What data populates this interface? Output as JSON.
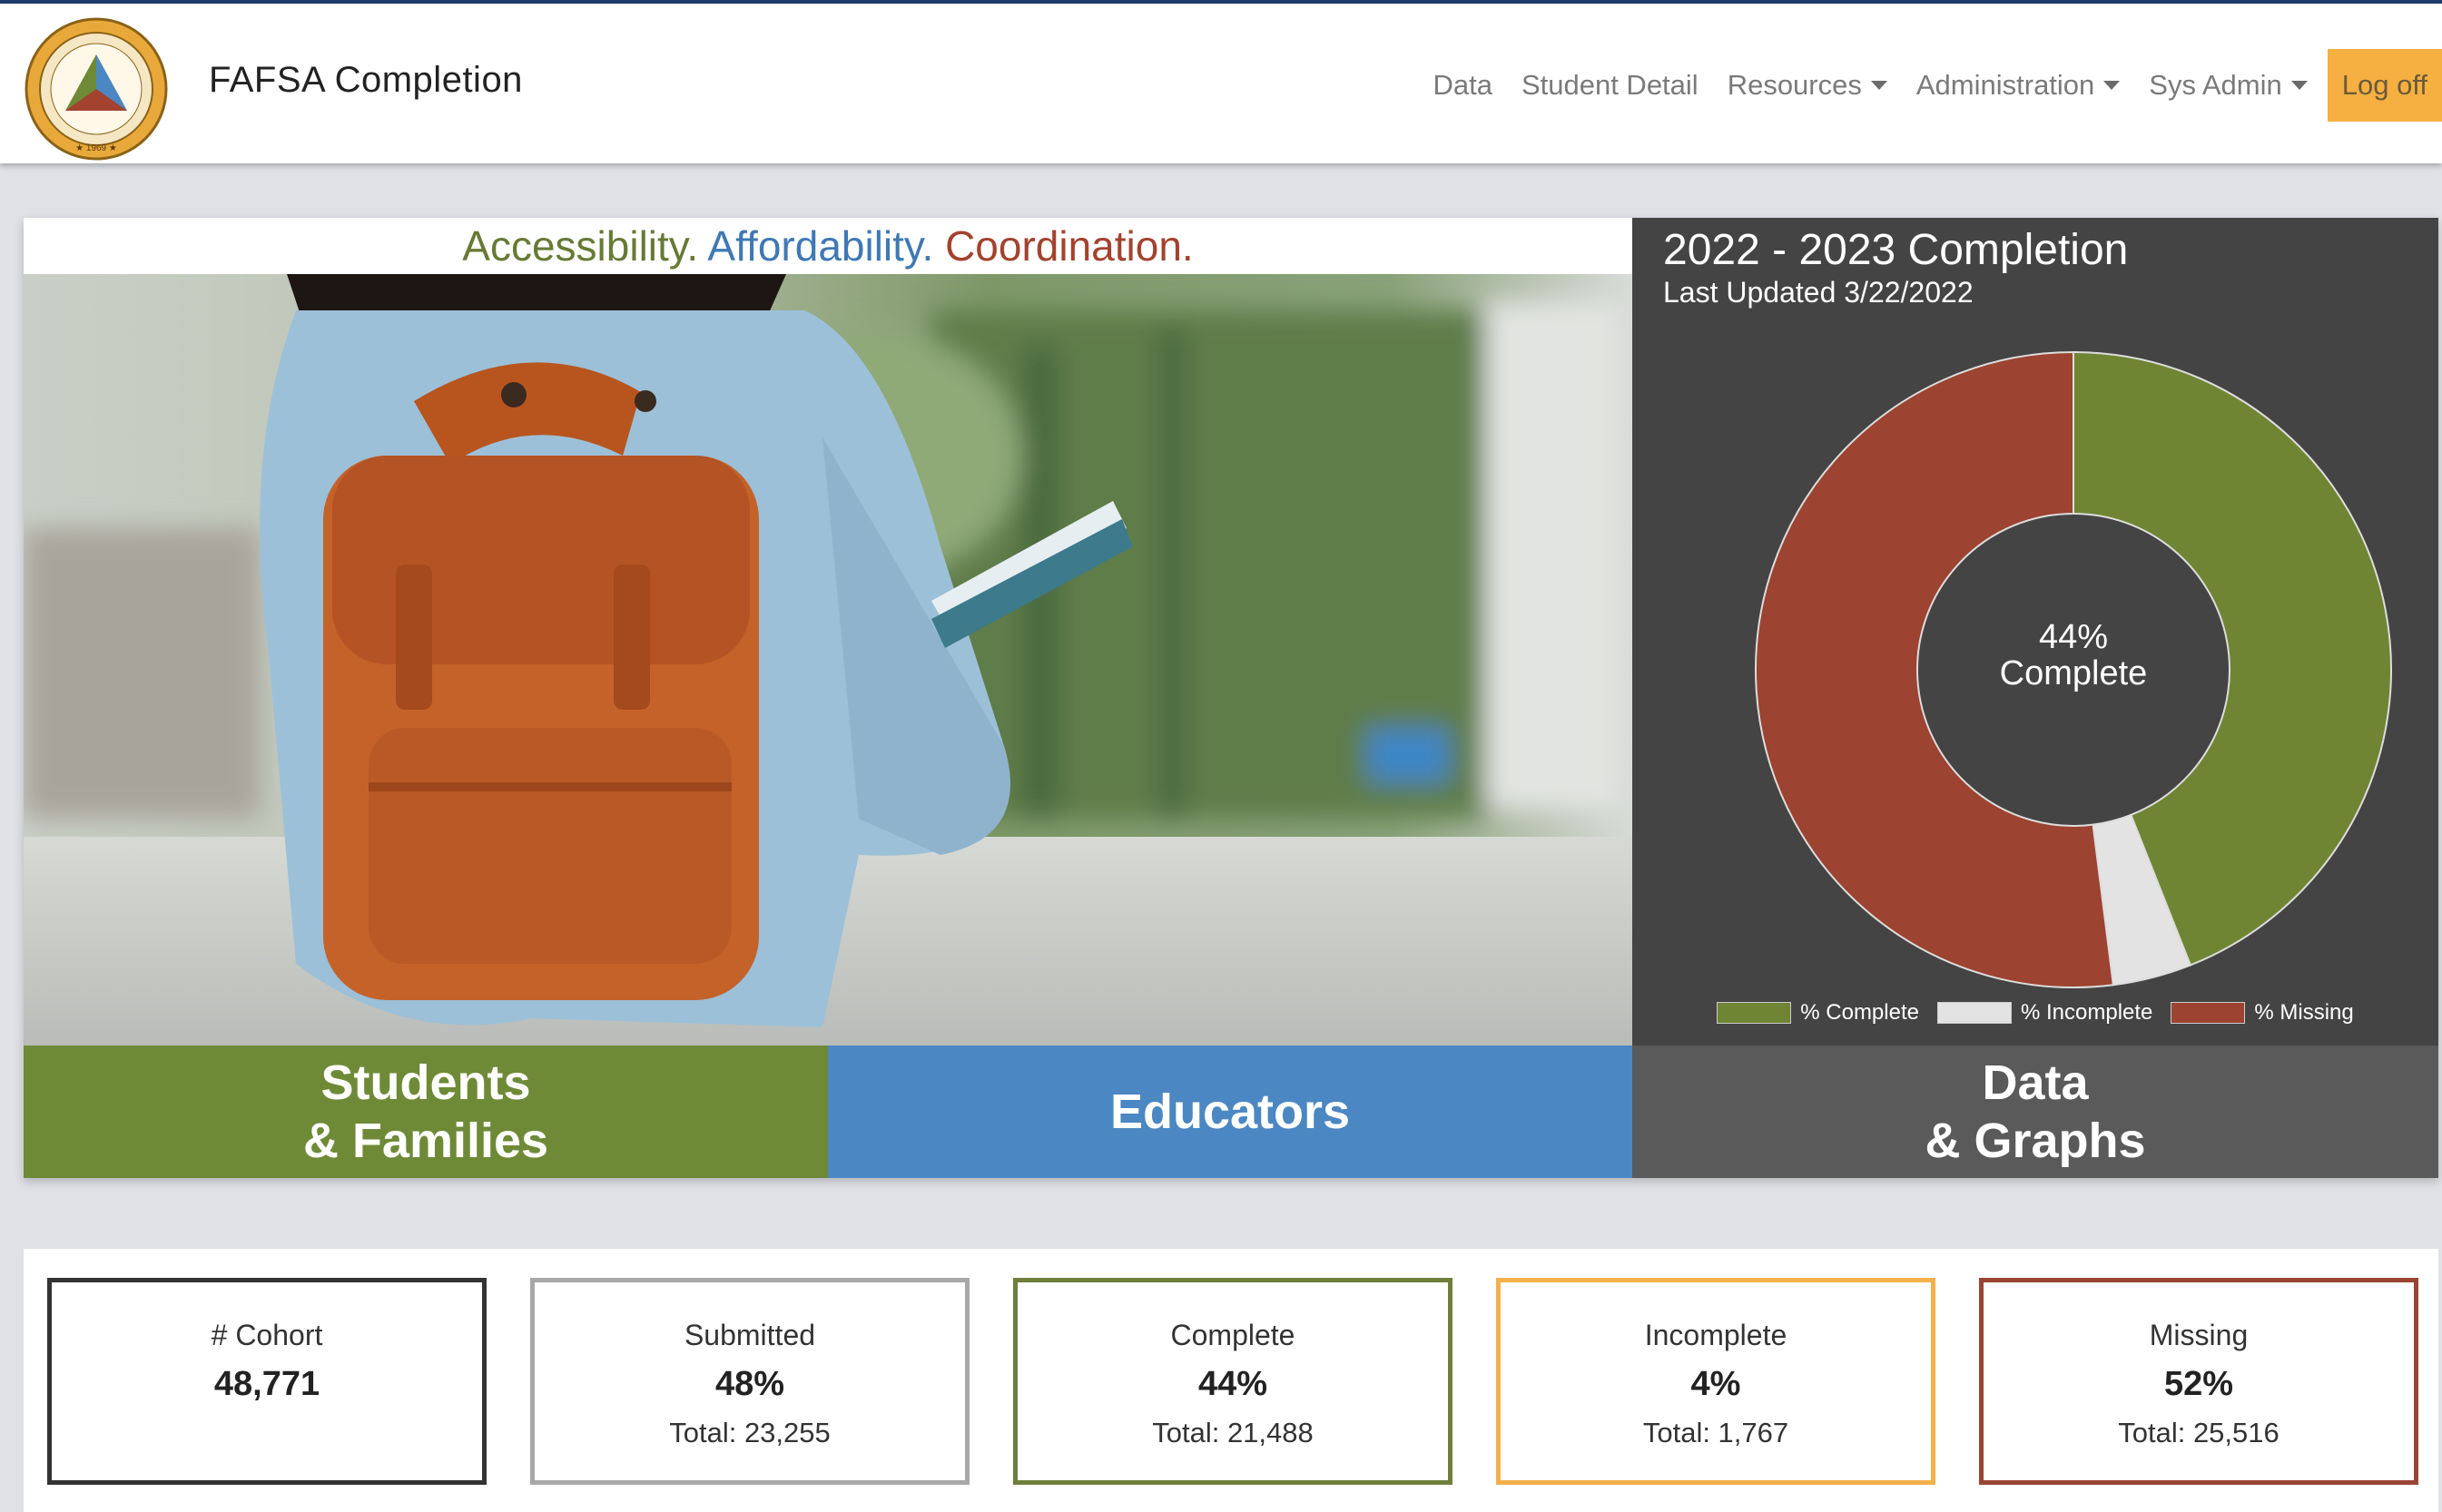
{
  "nav": {
    "brand": "FAFSA Completion",
    "items": [
      {
        "label": "Data",
        "dropdown": false
      },
      {
        "label": "Student Detail",
        "dropdown": false
      },
      {
        "label": "Resources",
        "dropdown": true
      },
      {
        "label": "Administration",
        "dropdown": true
      },
      {
        "label": "Sys Admin",
        "dropdown": true
      }
    ],
    "logoff": "Log off"
  },
  "tagline": {
    "part1": "Accessibility.",
    "part2": "Affordability.",
    "part3": "Coordination."
  },
  "tiles": {
    "students": [
      "Students",
      "& Families"
    ],
    "educators": "Educators",
    "data": [
      "Data",
      "& Graphs"
    ]
  },
  "chart": {
    "title": "2022 - 2023 Completion",
    "subtitle": "Last Updated 3/22/2022",
    "center_line1": "44%",
    "center_line2": "Complete"
  },
  "chart_data": {
    "type": "pie",
    "title": "2022 - 2023 Completion",
    "categories": [
      "% Complete",
      "% Incomplete",
      "% Missing"
    ],
    "values": [
      44,
      4,
      52
    ],
    "colors": [
      "#6f8533",
      "#e3e3e3",
      "#9c4331"
    ],
    "legend": "bottom"
  },
  "stats": [
    {
      "label": "# Cohort",
      "value": "48,771",
      "total": "",
      "color": "#333333"
    },
    {
      "label": "Submitted",
      "value": "48%",
      "total": "Total: 23,255",
      "color": "#a8a8a8"
    },
    {
      "label": "Complete",
      "value": "44%",
      "total": "Total: 21,488",
      "color": "#6f7f3a"
    },
    {
      "label": "Incomplete",
      "value": "4%",
      "total": "Total: 1,767",
      "color": "#f2b04a"
    },
    {
      "label": "Missing",
      "value": "52%",
      "total": "Total: 25,516",
      "color": "#9a4433"
    }
  ],
  "colors": {
    "nav_accent": "#1f3a6b",
    "logoff": "#f5b041",
    "students_tile": "#6e8a37",
    "educators_tile": "#4b87c2",
    "data_tile": "#5a5a5a",
    "chart_bg": "#444444"
  }
}
